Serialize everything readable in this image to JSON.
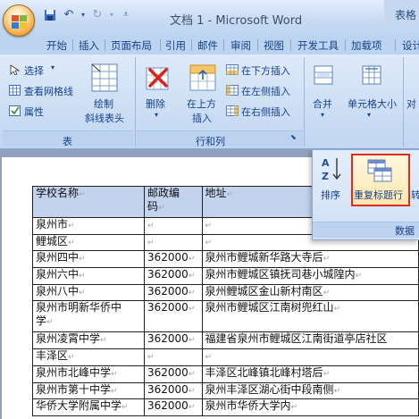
{
  "window": {
    "title": "文档 1 - Microsoft Word",
    "right_tab": "表格"
  },
  "tabs": [
    "开始",
    "插入",
    "页面布局",
    "引用",
    "邮件",
    "审阅",
    "视图",
    "开发工具",
    "加载项",
    "设计"
  ],
  "ribbon": {
    "table_group": {
      "select": "选择",
      "gridlines": "查看网格线",
      "properties": "属性",
      "draw_slash": [
        "绘制",
        "斜线表头"
      ],
      "label": "表"
    },
    "rows_cols_group": {
      "delete": "删除",
      "insert_above": [
        "在上方",
        "插入"
      ],
      "insert_below": "在下方插入",
      "insert_left": "在左侧插入",
      "insert_right": "在右侧插入",
      "label": "行和列"
    },
    "merge_group": {
      "merge": "合并",
      "cell_size": "单元格大小",
      "align_partial": "对"
    }
  },
  "popup": {
    "sort": "排序",
    "repeat_header": "重复标题行",
    "convert_partial": "转",
    "label_partial": "数据"
  },
  "table": {
    "headers": [
      "学校名称",
      "邮政编码",
      "地址"
    ],
    "header_zip_lines": [
      "邮政编",
      "码"
    ],
    "rows": [
      [
        "泉州市",
        "",
        ""
      ],
      [
        "鲤城区",
        "",
        ""
      ],
      [
        "泉州四中",
        "362000",
        "泉州市鲤城新华路大寺后"
      ],
      [
        "泉州六中",
        "362000",
        "泉州市鲤城区镇抚司巷小城隍内"
      ],
      [
        "泉州八中",
        "362000",
        "泉州鲤城区金山新村南区"
      ],
      [
        "泉州市明新华侨中学",
        "362000",
        "泉州市鲤城区江南树兜红山"
      ],
      [
        "泉州凌霄中学",
        "362000",
        "福建省泉州市鲤城区江南街道亭店社区"
      ],
      [
        "丰泽区",
        "",
        ""
      ],
      [
        "泉州市北峰中学",
        "362000",
        "丰泽区北峰镇北峰村塔后"
      ],
      [
        "泉州市第十中学",
        "362000",
        "泉州丰泽区湖心街中段南侧"
      ],
      [
        "华侨大学附属中学",
        "362000",
        "泉州市华侨大学内"
      ]
    ],
    "row5_lines": [
      "泉州市明新华侨中",
      "学"
    ]
  },
  "colors": {
    "accent": "#15428b",
    "highlight_border": "#e02c1c",
    "selected_cell": "#c3d3ed"
  }
}
